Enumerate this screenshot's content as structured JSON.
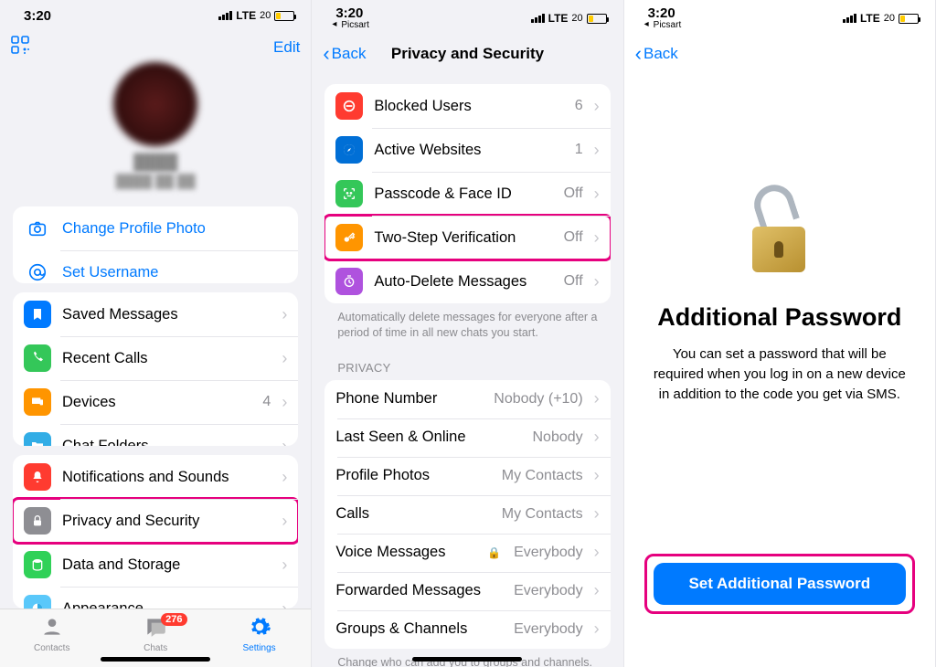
{
  "status": {
    "time": "3:20",
    "breadcrumb": "Picsart",
    "carrier": "LTE",
    "battery": "20"
  },
  "screen1": {
    "edit": "Edit",
    "change_photo": "Change Profile Photo",
    "set_username": "Set Username",
    "rowsA": [
      {
        "label": "Saved Messages",
        "value": ""
      },
      {
        "label": "Recent Calls",
        "value": ""
      },
      {
        "label": "Devices",
        "value": "4"
      },
      {
        "label": "Chat Folders",
        "value": ""
      }
    ],
    "rowsB": [
      {
        "label": "Notifications and Sounds"
      },
      {
        "label": "Privacy and Security",
        "highlight": true
      },
      {
        "label": "Data and Storage"
      },
      {
        "label": "Appearance"
      }
    ],
    "tabs": {
      "contacts": "Contacts",
      "chats": "Chats",
      "settings": "Settings",
      "badge": "276"
    }
  },
  "screen2": {
    "back": "Back",
    "title": "Privacy and Security",
    "security": [
      {
        "label": "Blocked Users",
        "value": "6"
      },
      {
        "label": "Active Websites",
        "value": "1"
      },
      {
        "label": "Passcode & Face ID",
        "value": "Off"
      },
      {
        "label": "Two-Step Verification",
        "value": "Off",
        "highlight": true
      },
      {
        "label": "Auto-Delete Messages",
        "value": "Off"
      }
    ],
    "security_footer": "Automatically delete messages for everyone after a period of time in all new chats you start.",
    "privacy_header": "PRIVACY",
    "privacy": [
      {
        "label": "Phone Number",
        "value": "Nobody (+10)"
      },
      {
        "label": "Last Seen & Online",
        "value": "Nobody"
      },
      {
        "label": "Profile Photos",
        "value": "My Contacts"
      },
      {
        "label": "Calls",
        "value": "My Contacts"
      },
      {
        "label": "Voice Messages",
        "value": "Everybody",
        "locked": true
      },
      {
        "label": "Forwarded Messages",
        "value": "Everybody"
      },
      {
        "label": "Groups & Channels",
        "value": "Everybody"
      }
    ],
    "privacy_footer": "Change who can add you to groups and channels."
  },
  "screen3": {
    "back": "Back",
    "title": "Additional Password",
    "desc": "You can set a password that will be required when you log in on a new device in addition to the code you get via SMS.",
    "cta": "Set Additional Password"
  }
}
